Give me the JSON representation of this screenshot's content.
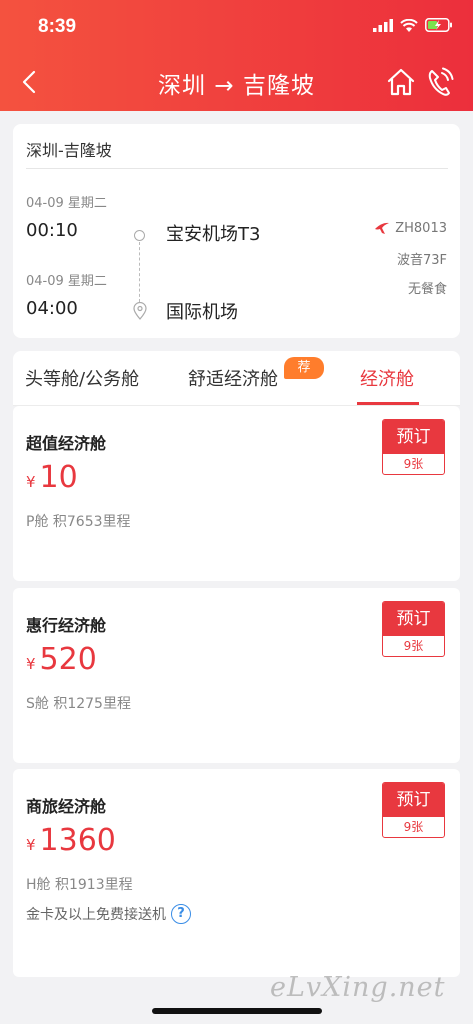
{
  "status_bar": {
    "time": "8:39"
  },
  "nav": {
    "title": "深圳 → 吉隆坡"
  },
  "flight": {
    "route": "深圳-吉隆坡",
    "dep_date": "04-09 星期二",
    "dep_time": "00:10",
    "dep_airport": "宝安机场T3",
    "arr_date": "04-09 星期二",
    "arr_time": "04:00",
    "arr_airport": "国际机场",
    "flight_no": "ZH8013",
    "aircraft": "波音73F",
    "meal": "无餐食"
  },
  "tabs": [
    {
      "label": "头等舱/公务舱"
    },
    {
      "label": "舒适经济舱",
      "badge": "荐"
    },
    {
      "label": "经济舱",
      "active": true
    }
  ],
  "fares": [
    {
      "name": "超值经济舱",
      "currency": "¥",
      "price": "10",
      "meta": "P舱 积7653里程",
      "book_label": "预订",
      "seats": "9张"
    },
    {
      "name": "惠行经济舱",
      "currency": "¥",
      "price": "520",
      "meta": "S舱 积1275里程",
      "book_label": "预订",
      "seats": "9张"
    },
    {
      "name": "商旅经济舱",
      "currency": "¥",
      "price": "1360",
      "meta": "H舱 积1913里程",
      "book_label": "预订",
      "seats": "9张",
      "extra": "金卡及以上免费接送机"
    }
  ],
  "watermark": "eLvXing.net",
  "colors": {
    "brand_red": "#e8383f",
    "badge_orange": "#ff7d2c",
    "help_blue": "#3a8de6"
  }
}
